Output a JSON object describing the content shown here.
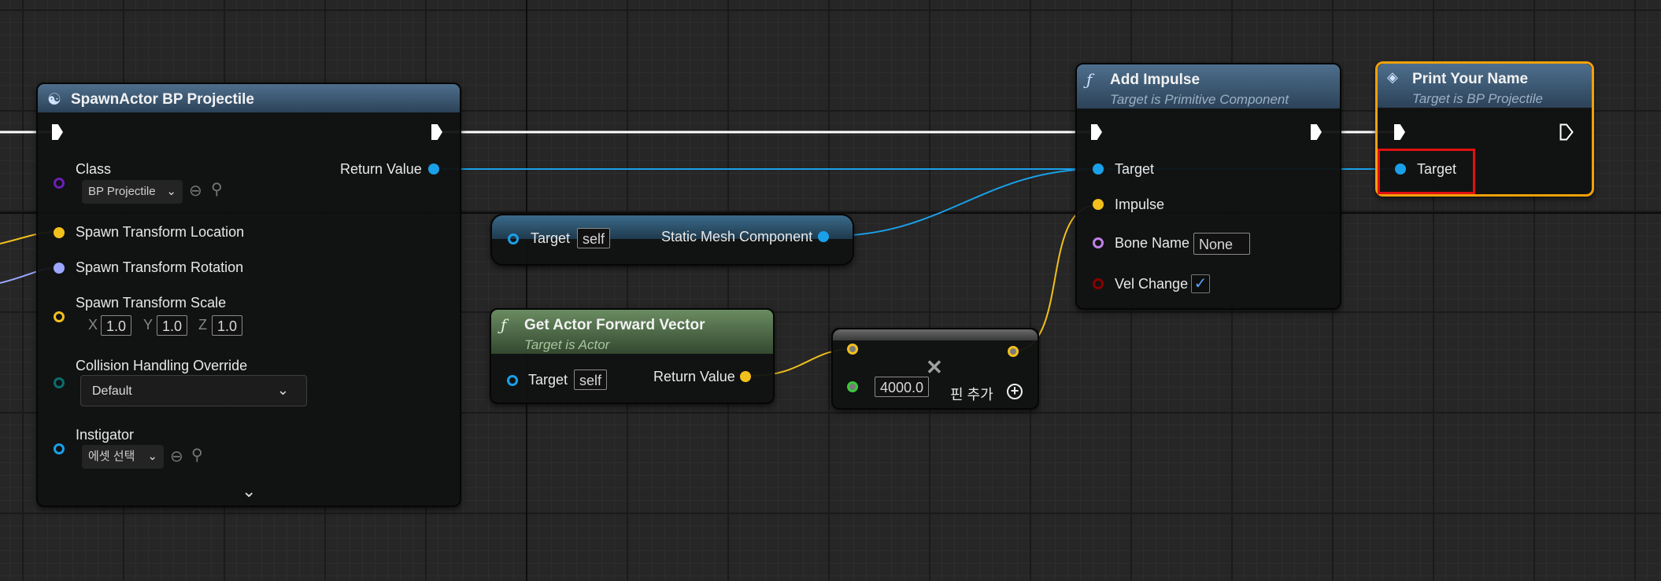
{
  "colors": {
    "exec": "#ffffff",
    "object_pin": "#1aa0e8",
    "vector_pin": "#f2c01c",
    "rotator_pin": "#9ca7ff",
    "transform_pin": "#f2c01c",
    "class_pin": "#6b1fb8",
    "name_pin": "#c080e8",
    "bool_pin": "#8a0000",
    "float_pin": "#3cc93c",
    "enum_pin": "#0a6e6e",
    "selected_border": "#f2a00a",
    "highlight_box": "#e01010"
  },
  "spawn_actor": {
    "title": "SpawnActor BP Projectile",
    "icon": "spawn-actor-icon",
    "class_label": "Class",
    "class_value": "BP Projectile",
    "return_value_label": "Return Value",
    "spawn_location_label": "Spawn Transform Location",
    "spawn_rotation_label": "Spawn Transform Rotation",
    "spawn_scale_label": "Spawn Transform Scale",
    "scale_x_label": "X",
    "scale_x_value": "1.0",
    "scale_y_label": "Y",
    "scale_y_value": "1.0",
    "scale_z_label": "Z",
    "scale_z_value": "1.0",
    "collision_label": "Collision Handling Override",
    "collision_value": "Default",
    "instigator_label": "Instigator",
    "instigator_value": "에셋 선택",
    "expand_icon": "chevron-down-icon"
  },
  "static_mesh_getter": {
    "target_label": "Target",
    "target_value": "self",
    "output_label": "Static Mesh Component"
  },
  "get_forward_vector": {
    "title": "Get Actor Forward Vector",
    "subtitle": "Target is Actor",
    "icon": "function-icon",
    "target_label": "Target",
    "target_value": "self",
    "return_value_label": "Return Value"
  },
  "multiply_node": {
    "value": "4000.0",
    "add_pin_label": "핀 추가",
    "operator_icon": "multiply-icon",
    "add_icon": "plus-circle-icon"
  },
  "add_impulse": {
    "title": "Add Impulse",
    "subtitle": "Target is Primitive Component",
    "icon": "function-icon",
    "target_label": "Target",
    "impulse_label": "Impulse",
    "bone_name_label": "Bone Name",
    "bone_name_value": "None",
    "vel_change_label": "Vel Change",
    "vel_change_checked": true
  },
  "print_your_name": {
    "title": "Print Your Name",
    "subtitle": "Target is BP Projectile",
    "icon": "event-icon",
    "target_label": "Target"
  }
}
